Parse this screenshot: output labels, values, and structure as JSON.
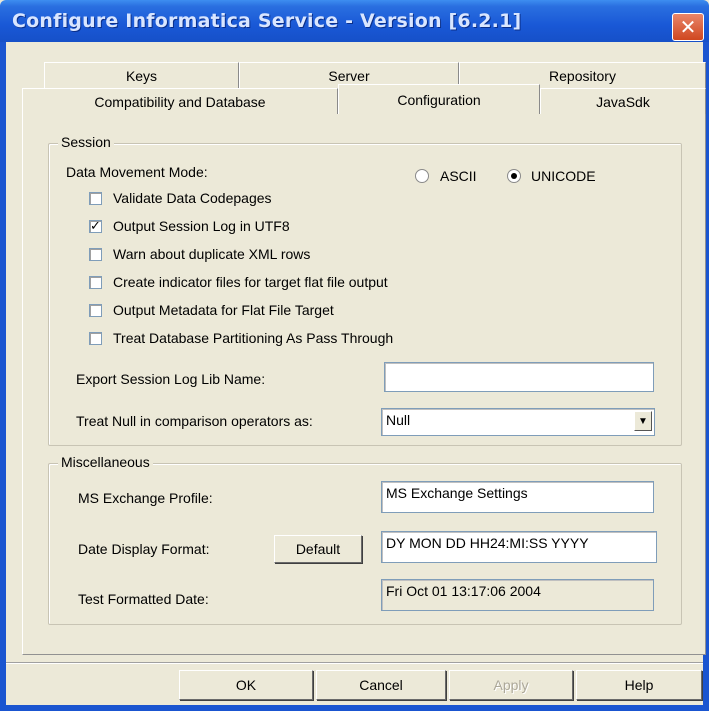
{
  "window": {
    "title": "Configure Informatica Service - Version [6.2.1]",
    "close_glyph": "✕"
  },
  "tabs": {
    "row1": [
      "Keys",
      "Server",
      "Repository"
    ],
    "row2": [
      "Compatibility and Database",
      "Configuration",
      "JavaSdk"
    ],
    "selected": "Configuration"
  },
  "session": {
    "group_title": "Session",
    "data_movement_label": "Data Movement Mode:",
    "radio_ascii": "ASCII",
    "radio_unicode": "UNICODE",
    "selected_mode": "UNICODE",
    "checkboxes": [
      {
        "label": "Validate Data Codepages",
        "checked": false
      },
      {
        "label": "Output Session Log in UTF8",
        "checked": true
      },
      {
        "label": "Warn about duplicate XML rows",
        "checked": false
      },
      {
        "label": "Create indicator files for target flat file output",
        "checked": false
      },
      {
        "label": "Output Metadata for Flat File Target",
        "checked": false
      },
      {
        "label": "Treat Database Partitioning As Pass Through",
        "checked": false
      }
    ],
    "export_log_label": "Export Session Log Lib Name:",
    "export_log_value": "",
    "treat_null_label": "Treat Null in comparison operators as:",
    "treat_null_value": "Null"
  },
  "misc": {
    "group_title": "Miscellaneous",
    "ms_exchange_label": "MS Exchange Profile:",
    "ms_exchange_value": "MS Exchange Settings",
    "date_format_label": "Date Display Format:",
    "default_button": "Default",
    "date_format_value": "DY MON DD HH24:MI:SS YYYY",
    "test_date_label": "Test Formatted Date:",
    "test_date_value": "Fri Oct 01 13:17:06 2004"
  },
  "buttons": {
    "ok": "OK",
    "cancel": "Cancel",
    "apply": "Apply",
    "help": "Help"
  }
}
